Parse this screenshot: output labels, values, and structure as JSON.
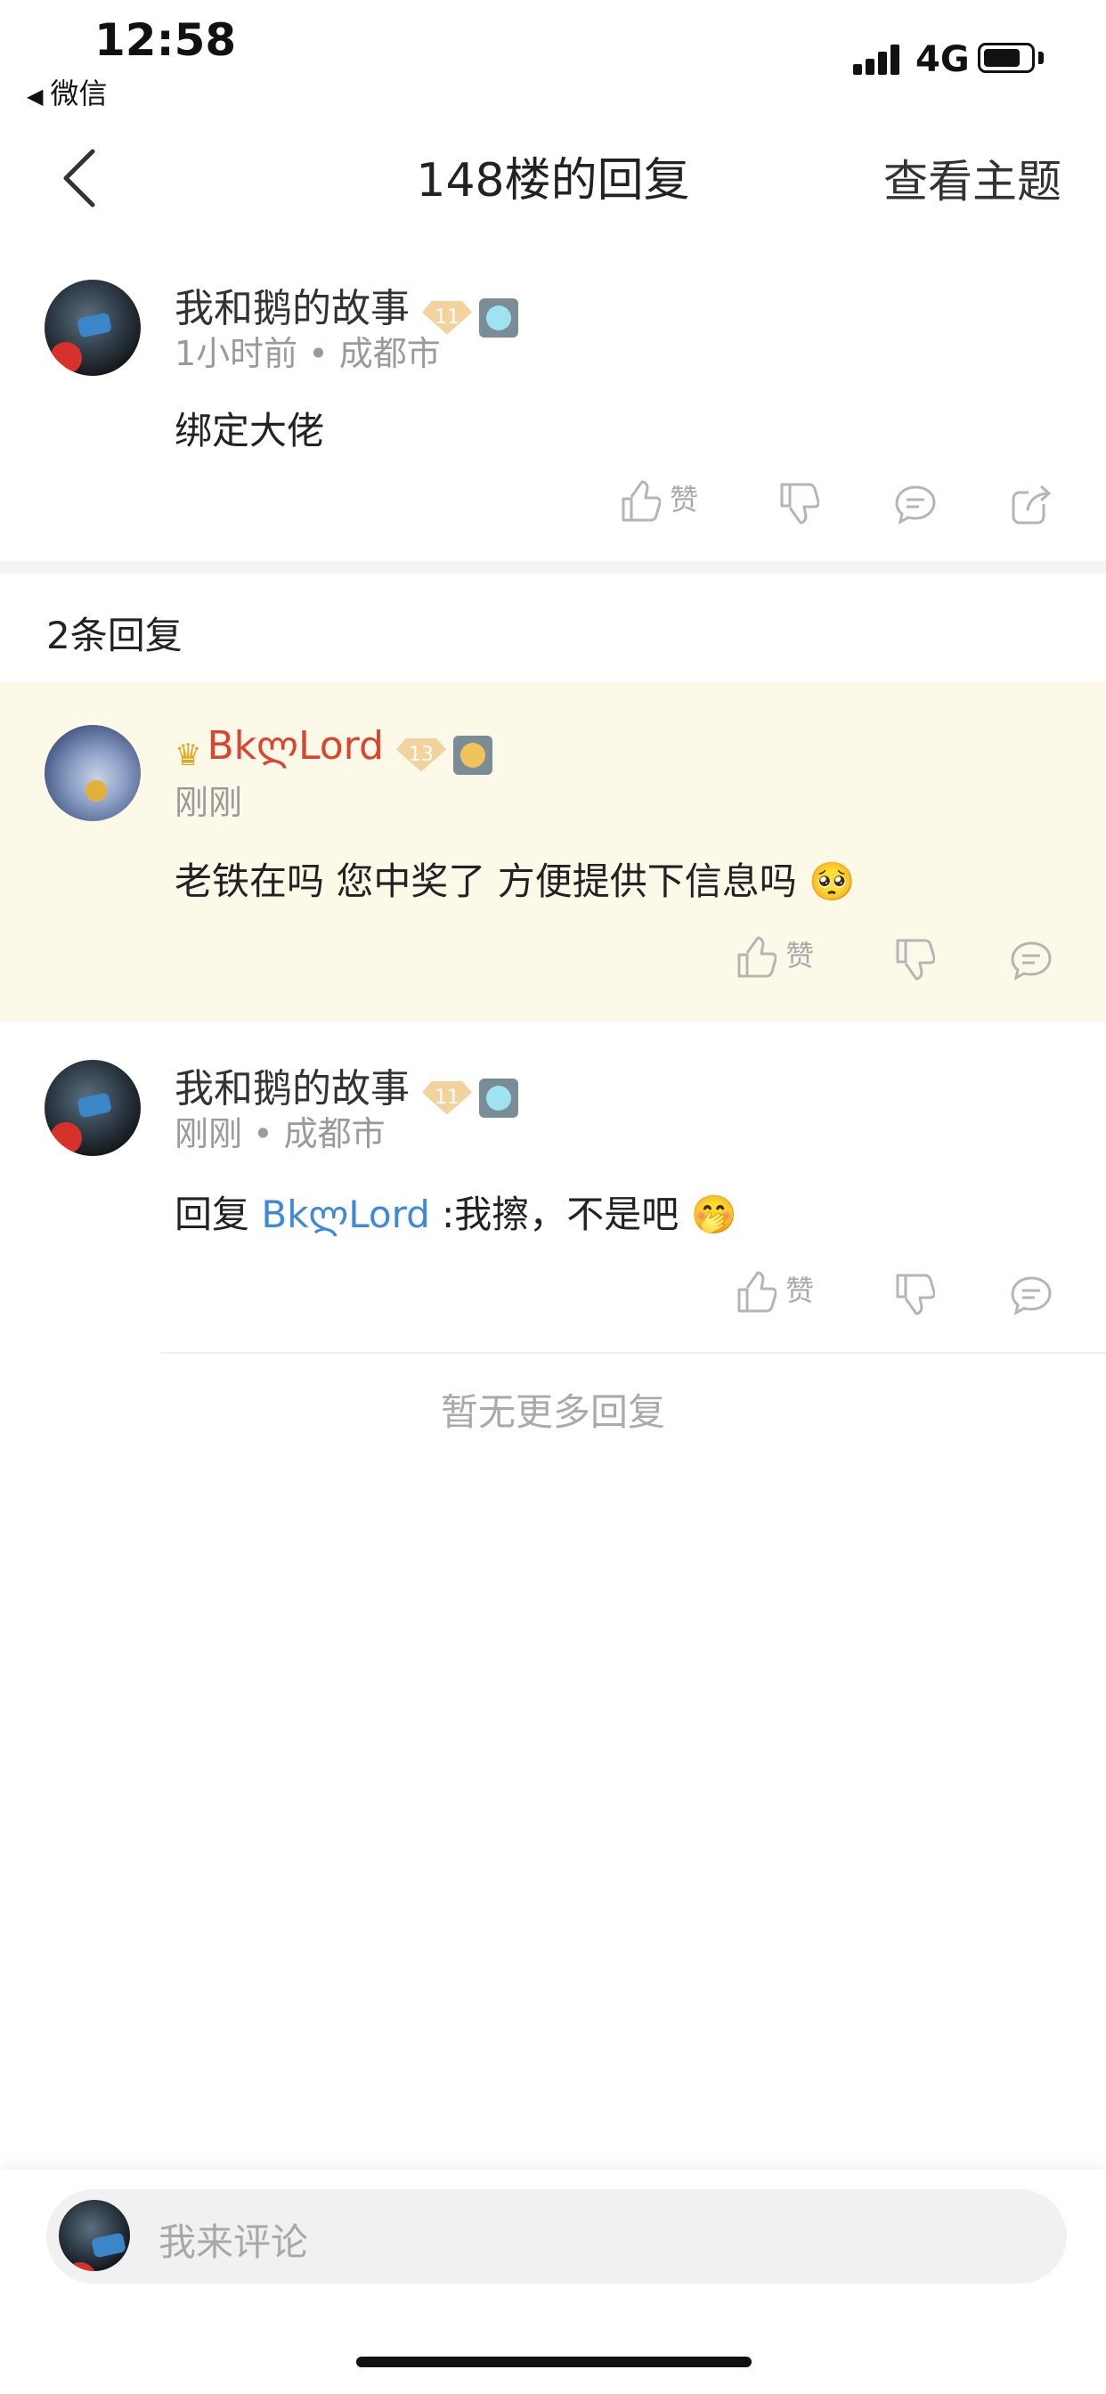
{
  "status_bar": {
    "time": "12:58",
    "back_app": "微信",
    "network": "4G"
  },
  "nav": {
    "title": "148楼的回复",
    "view_topic": "查看主题"
  },
  "main_post": {
    "username": "我和鹅的故事",
    "level": "11",
    "time": "1小时前",
    "location": "成都市",
    "content": "绑定大佬",
    "like_label": "赞"
  },
  "replies_count": "2条回复",
  "replies": [
    {
      "username": "BkლLord",
      "level": "13",
      "time": "刚刚",
      "content": "老铁在吗 您中奖了 方便提供下信息吗",
      "emoji": "🥺",
      "like_label": "赞"
    },
    {
      "username": "我和鹅的故事",
      "level": "11",
      "time": "刚刚",
      "location": "成都市",
      "reply_prefix": "回复",
      "reply_to": "BkლLord",
      "content": ":我擦，不是吧",
      "emoji": "🤭",
      "like_label": "赞"
    }
  ],
  "no_more": "暂无更多回复",
  "comment_input": {
    "placeholder": "我来评论"
  },
  "colors": {
    "highlight_bg": "#fdf9e8",
    "username_red": "#d9452f",
    "link_blue": "#3c8ad9"
  }
}
